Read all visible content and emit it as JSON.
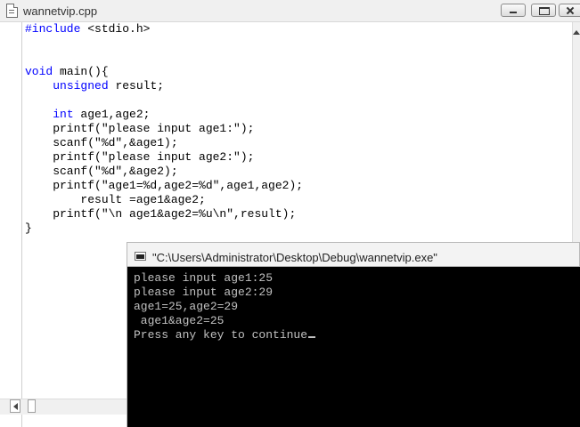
{
  "editor": {
    "title": "wannetvip.cpp",
    "code_lines": [
      [
        {
          "t": "#include",
          "k": true
        },
        {
          "t": " <stdio.h>",
          "k": false
        }
      ],
      [],
      [],
      [
        {
          "t": "void",
          "k": true
        },
        {
          "t": " main(){",
          "k": false
        }
      ],
      [
        {
          "t": "    ",
          "k": false
        },
        {
          "t": "unsigned",
          "k": true
        },
        {
          "t": " result;",
          "k": false
        }
      ],
      [],
      [
        {
          "t": "    ",
          "k": false
        },
        {
          "t": "int",
          "k": true
        },
        {
          "t": " age1,age2;",
          "k": false
        }
      ],
      [
        {
          "t": "    printf(\"please input age1:\");",
          "k": false
        }
      ],
      [
        {
          "t": "    scanf(\"%d\",&age1);",
          "k": false
        }
      ],
      [
        {
          "t": "    printf(\"please input age2:\");",
          "k": false
        }
      ],
      [
        {
          "t": "    scanf(\"%d\",&age2);",
          "k": false
        }
      ],
      [
        {
          "t": "    printf(\"age1=%d,age2=%d\",age1,age2);",
          "k": false
        }
      ],
      [
        {
          "t": "        result =age1&age2;",
          "k": false
        }
      ],
      [
        {
          "t": "    printf(\"\\n age1&age2=%u\\n\",result);",
          "k": false
        }
      ],
      [
        {
          "t": "}",
          "k": false
        }
      ]
    ]
  },
  "console": {
    "title": "\"C:\\Users\\Administrator\\Desktop\\Debug\\wannetvip.exe\"",
    "lines": [
      "please input age1:25",
      "please input age2:29",
      "age1=25,age2=29",
      " age1&age2=25",
      "Press any key to continue"
    ]
  },
  "colors": {
    "keyword": "#0000ff",
    "console_text": "#c0c0c0",
    "console_bg": "#000000"
  }
}
